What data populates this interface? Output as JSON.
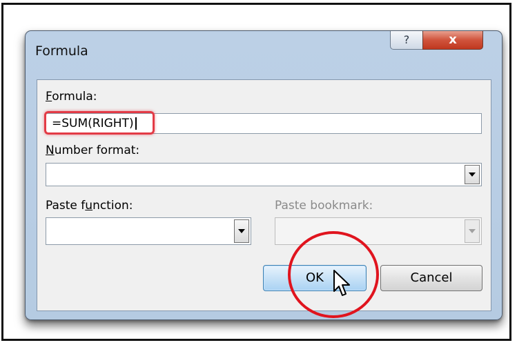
{
  "dialog": {
    "title": "Formula",
    "help_icon": "?",
    "close_icon": "x"
  },
  "formula": {
    "label_text": "ormula:",
    "label_mnemonic": "F",
    "value": "=SUM(RIGHT)"
  },
  "number_format": {
    "label_mnemonic": "N",
    "label_text": "umber format:",
    "value": ""
  },
  "paste_function": {
    "label_before": "Paste f",
    "label_mnemonic": "u",
    "label_after": "nction:",
    "value": ""
  },
  "paste_bookmark": {
    "label": "Paste bookmark:",
    "value": ""
  },
  "buttons": {
    "ok": "OK",
    "cancel": "Cancel"
  },
  "colors": {
    "highlight": "#e33b46",
    "annotation_circle": "#e0141e",
    "ok_border": "#3c7fb1"
  },
  "annotations": [
    "red-highlight-box",
    "red-circle"
  ],
  "icons": [
    "help-icon",
    "close-icon",
    "chevron-down-icon",
    "mouse-pointer-icon"
  ]
}
